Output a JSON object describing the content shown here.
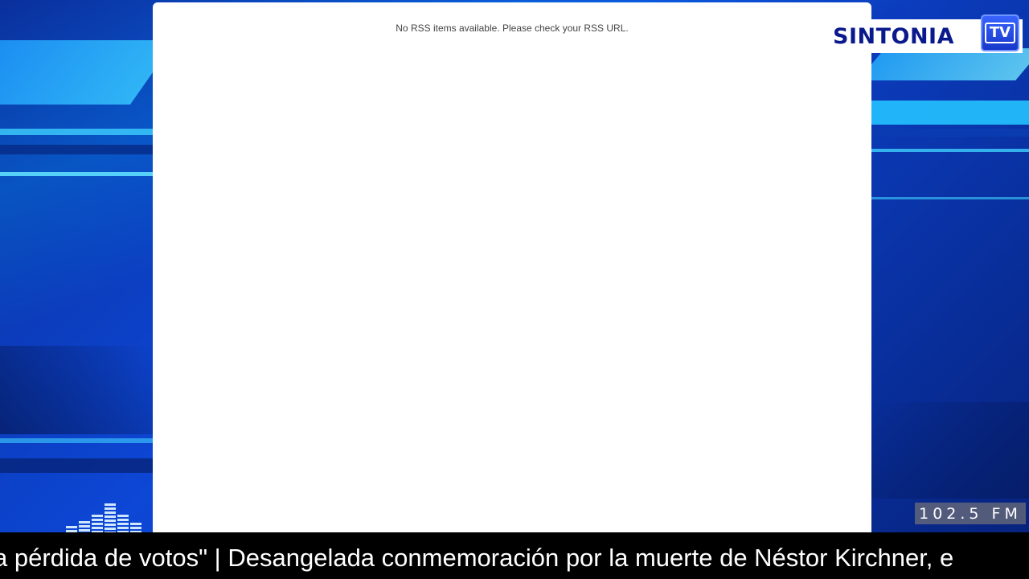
{
  "rss": {
    "message": "No RSS items available. Please check your RSS URL."
  },
  "logo": {
    "word": "SINTONIA",
    "badge": "TV"
  },
  "radio": {
    "frequency": "102.5 FM"
  },
  "ticker": {
    "text": "a pérdida de votos\" | Desangelada conmemoración por la muerte de Néstor Kirchner, e"
  },
  "colors": {
    "background": "#0d47d6",
    "panel": "#ffffff",
    "logo_text": "#0a1a8c",
    "ticker_bg": "#000000"
  },
  "icons": {
    "equalizer": "equalizer-icon"
  }
}
